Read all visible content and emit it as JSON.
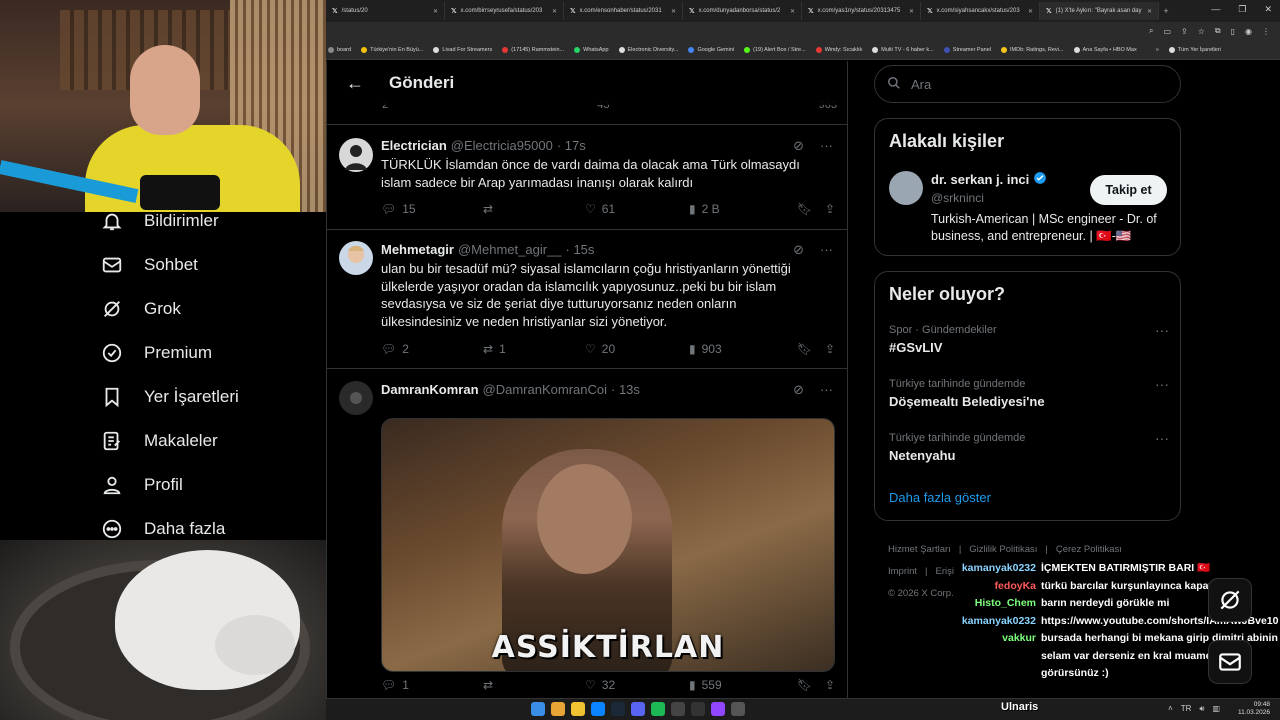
{
  "browser": {
    "tabs": [
      {
        "title": "/status/20",
        "close": "✕"
      },
      {
        "title": "x.com/birrseyrusefa/status/203",
        "close": "✕"
      },
      {
        "title": "x.com/ensonhaber/status/2031",
        "close": "✕"
      },
      {
        "title": "x.com/dunyadanborsa/status/2",
        "close": "✕"
      },
      {
        "title": "x.com/yas1ny/status/20313475",
        "close": "✕"
      },
      {
        "title": "x.com/siyahsancakx/status/203",
        "close": "✕"
      },
      {
        "title": "(1) X'te Aykırı: \"Bayrak asan day",
        "close": "✕"
      }
    ],
    "new_tab": "+",
    "bookmarks": [
      {
        "label": "board",
        "color": "#888888"
      },
      {
        "label": "Türkiye'nin En Büyü...",
        "color": "#f4c20d"
      },
      {
        "label": "Livad For Streamers",
        "color": "#dddddd"
      },
      {
        "label": "(17145) Rammstein...",
        "color": "#e53935"
      },
      {
        "label": "WhatsApp",
        "color": "#25d366"
      },
      {
        "label": "Electronic Diversity...",
        "color": "#dddddd"
      },
      {
        "label": "Google Gemini",
        "color": "#4285f4"
      },
      {
        "label": "(19) Alert Box / Stre...",
        "color": "#53fc18"
      },
      {
        "label": "Windy: Sıcaklık",
        "color": "#e53935"
      },
      {
        "label": "Multi TV - 6 haber k...",
        "color": "#dddddd"
      },
      {
        "label": "Streamer Panel",
        "color": "#3f51b5"
      },
      {
        "label": "IMDb: Ratings, Revi...",
        "color": "#f5c518"
      },
      {
        "label": "Ana Sayfa • HBO Max",
        "color": "#dddddd"
      },
      {
        "label": "»",
        "color": "#2b2b2b"
      },
      {
        "label": "Tüm Yer İşaretleri",
        "color": "#dddddd"
      }
    ]
  },
  "nav": {
    "items": [
      {
        "label": "Bildirimler",
        "icon": "bell-icon"
      },
      {
        "label": "Sohbet",
        "icon": "mail-icon"
      },
      {
        "label": "Grok",
        "icon": "grok-icon"
      },
      {
        "label": "Premium",
        "icon": "verified-icon"
      },
      {
        "label": "Yer İşaretleri",
        "icon": "bookmark-icon"
      },
      {
        "label": "Makaleler",
        "icon": "article-icon"
      },
      {
        "label": "Profil",
        "icon": "person-icon"
      },
      {
        "label": "Daha fazla",
        "icon": "more-circle-icon"
      }
    ]
  },
  "header": {
    "title": "Gönderi",
    "back": "←"
  },
  "prev_post": {
    "replies": "2",
    "likes": "43",
    "views": "903"
  },
  "posts": [
    {
      "name": "Electrician",
      "handle": "@Electricia95000",
      "time": "· 17s",
      "text": "TÜRKLÜK İslamdan önce de vardı daima da olacak ama Türk olmasaydı islam sadece bir Arap yarımadası inanışı olarak kalırdı",
      "replies": "15",
      "reposts": "",
      "likes": "61",
      "views": "2 B",
      "avatar_color": "#d8d8d8"
    },
    {
      "name": "Mehmetagir",
      "handle": "@Mehmet_agir__",
      "time": "· 15s",
      "text": "ulan bu bir tesadüf mü? siyasal islamcıların çoğu hristiyanların yönettiği ülkelerde yaşıyor oradan da islamcılık yapıyosunuz..peki bu bir islam sevdasıysa ve siz de şeriat diye tutturuyorsanız neden onların ülkesindesiniz ve neden hristiyanlar sizi yönetiyor.",
      "replies": "2",
      "reposts": "1",
      "likes": "20",
      "views": "903",
      "avatar_color": "#c9d7e6"
    },
    {
      "name": "DamranKomran",
      "handle": "@DamranKomranCoi",
      "time": "· 13s",
      "text": "",
      "media_caption": "ASSİKTİRLAN",
      "replies": "1",
      "reposts": "",
      "likes": "32",
      "views": "559",
      "avatar_color": "#2a2a2a"
    }
  ],
  "right": {
    "search_placeholder": "Ara",
    "related": {
      "title": "Alakalı kişiler",
      "name": "dr. serkan j. inci",
      "handle": "@srkninci",
      "bio": "Turkish-American | MSc engineer - Dr. of business, and entrepreneur. | 🇹🇷-🇺🇸",
      "follow": "Takip et"
    },
    "trends": {
      "title": "Neler oluyor?",
      "items": [
        {
          "meta": "Spor · Gündemdekiler",
          "name": "#GSvLIV"
        },
        {
          "meta": "Türkiye tarihinde gündemde",
          "name": "Döşemealtı Belediyesi'ne"
        },
        {
          "meta": "Türkiye tarihinde gündemde",
          "name": "Netenyahu"
        }
      ],
      "show_more": "Daha fazla göster"
    },
    "footer": [
      "Hizmet Şartları",
      "|",
      "Gizlilik Politikası",
      "|",
      "Çerez Politikası",
      "|",
      "Imprint",
      "|",
      "Erişi",
      "© 2026 X Corp."
    ]
  },
  "chat": [
    {
      "user": "kamanyak0232",
      "msg": "İÇMEKTEN BATIRMIŞTIR BARI 🇹🇷",
      "color": "#8ad4ff"
    },
    {
      "user": "fedoyKa",
      "msg": "türkü barcılar kurşunlayınca kapatmış",
      "color": "#ff5a5a"
    },
    {
      "user": "Histo_Chem",
      "msg": "barın nerdeydi görükle mi",
      "color": "#7dff7d"
    },
    {
      "user": "kamanyak0232",
      "msg": "https://www.youtube.com/shorts/IAmAwJBve10",
      "color": "#8ad4ff"
    },
    {
      "user": "vakkur",
      "msg": "bursada herhangi bi mekana girip dimitri abinin selam var derseniz en kral muameleyi görürsünüz :)",
      "color": "#7dff7d"
    }
  ],
  "taskbar": {
    "user": "Ulnaris",
    "time": "09:48",
    "date": "11.03.2026"
  }
}
